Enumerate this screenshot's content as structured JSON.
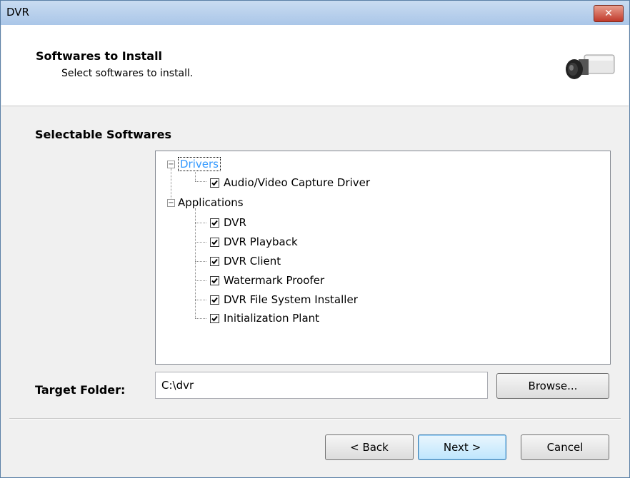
{
  "window": {
    "title": "DVR",
    "close_symbol": "✕"
  },
  "header": {
    "title": "Softwares to Install",
    "subtitle": "Select softwares to install."
  },
  "section": {
    "label": "Selectable Softwares"
  },
  "tree": {
    "groups": [
      {
        "label": "Drivers",
        "expander": "−",
        "selected": true,
        "items": [
          {
            "label": "Audio/Video Capture Driver",
            "checked": true
          }
        ]
      },
      {
        "label": "Applications",
        "expander": "−",
        "selected": false,
        "items": [
          {
            "label": "DVR",
            "checked": true
          },
          {
            "label": "DVR Playback",
            "checked": true
          },
          {
            "label": "DVR Client",
            "checked": true
          },
          {
            "label": "Watermark Proofer",
            "checked": true
          },
          {
            "label": "DVR File System Installer",
            "checked": true
          },
          {
            "label": "Initialization Plant",
            "checked": true
          }
        ]
      }
    ]
  },
  "target": {
    "label": "Target Folder:",
    "value": "C:\\dvr"
  },
  "buttons": {
    "browse": "Browse...",
    "back": "< Back",
    "next": "Next >",
    "cancel": "Cancel"
  },
  "colors": {
    "selection_text": "#3399ff",
    "default_button_border": "#3c7fb1"
  }
}
